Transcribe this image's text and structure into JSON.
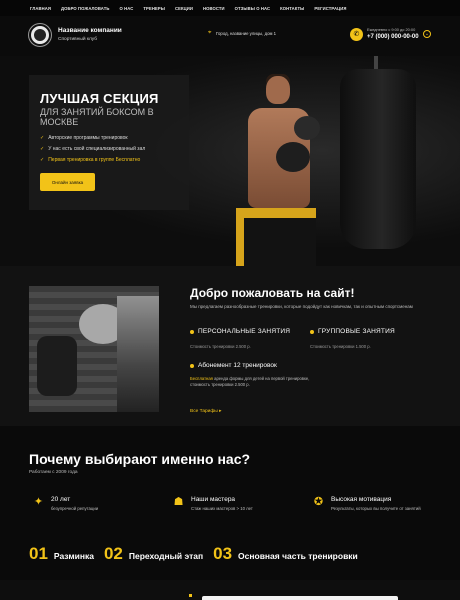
{
  "nav": [
    "ГЛАВНАЯ",
    "ДОБРО ПОЖАЛОВАТЬ",
    "О НАС",
    "ТРЕНЕРЫ",
    "СЕКЦИИ",
    "НОВОСТИ",
    "ОТЗЫВЫ О НАС",
    "КОНТАКТЫ",
    "РЕГИСТРАЦИЯ"
  ],
  "header": {
    "company": "Название компании",
    "subtitle": "Спортивный клуб",
    "address": "Город, название улицы, дом 1",
    "hours": "Ежедневно с 9:00 до 20:00",
    "phone": "+7 (000) 000-00-00"
  },
  "hero": {
    "title": "ЛУЧШАЯ СЕКЦИЯ",
    "subtitle": "ДЛЯ ЗАНЯТИЙ БОКСОМ В МОСКВЕ",
    "checks": [
      "Авторские программы тренировок",
      "У нас есть свой специализированный зал",
      "Первая тренировка в группе Бесплатно"
    ],
    "button": "Онлайн заявка"
  },
  "welcome": {
    "title": "Добро пожаловать на сайт!",
    "text": "Мы предлагаем разнообразные тренировки, которые подойдут как новичкам, так и опытным спортсменам",
    "services": [
      {
        "name": "ПЕРСОНАЛЬНЫЕ ЗАНЯТИЯ",
        "price": "Стоимость тренировки 2.500 р."
      },
      {
        "name": "ГРУППОВЫЕ ЗАНЯТИЯ",
        "price": "Стоимость тренировки 1.500 р."
      }
    ],
    "subscription": "Абонемент 12 тренировок",
    "sub_highlight": "Бесплатная",
    "sub_text": " аренда формы для детей на первой тренировке, стоимость тренировки 2.500 р.",
    "all_tariffs": "Все Тарифы"
  },
  "why": {
    "title": "Почему выбирают именно нас?",
    "since": "Работаем с 2009 года",
    "features": [
      {
        "icon": "handshake-icon",
        "title": "20 лет",
        "desc": "безупречной репутации"
      },
      {
        "icon": "trainers-icon",
        "title": "Наши мастера",
        "desc": "Стаж наших мастеров > 10 лет"
      },
      {
        "icon": "motivation-icon",
        "title": "Высокая мотивация",
        "desc": "Результаты, которых вы получите от занятий"
      }
    ],
    "steps": [
      {
        "num": "01",
        "label": "Разминка"
      },
      {
        "num": "02",
        "label": "Переходный этап"
      },
      {
        "num": "03",
        "label": "Основная часть тренировки"
      }
    ]
  },
  "colors": {
    "accent": "#f2c318",
    "background": "#0b0b0b"
  }
}
